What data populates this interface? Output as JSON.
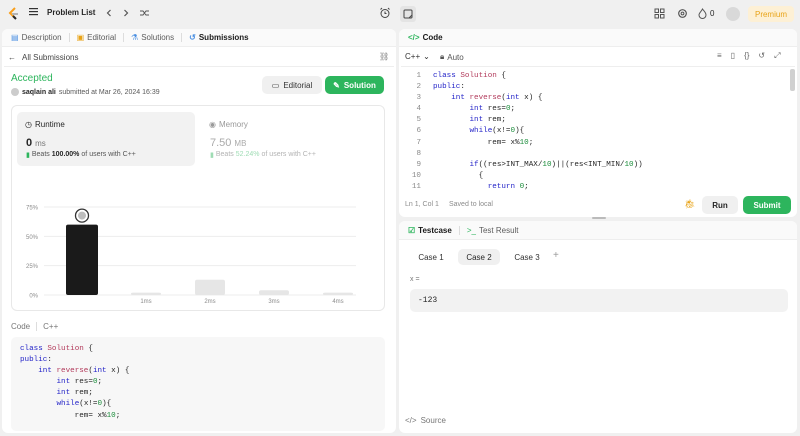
{
  "topbar": {
    "problem_list": "Problem List",
    "streak": "0",
    "premium": "Premium"
  },
  "left": {
    "tabs": [
      {
        "label": "Description"
      },
      {
        "label": "Editorial"
      },
      {
        "label": "Solutions"
      },
      {
        "label": "Submissions"
      }
    ],
    "back_label": "All Submissions",
    "status": "Accepted",
    "user": "saqlain ali",
    "submitted": "submitted at Mar 26, 2024 16:39",
    "editorial_btn": "Editorial",
    "solution_btn": "Solution",
    "runtime": {
      "title": "Runtime",
      "value": "0",
      "unit": "ms",
      "beats_label": "Beats",
      "beats_value": "100.00%",
      "beats_suffix": "of users with C++"
    },
    "memory": {
      "title": "Memory",
      "value": "7.50",
      "unit": "MB",
      "beats_label": "Beats",
      "beats_value": "52.24%",
      "beats_suffix": "of users with C++"
    },
    "code_label": "Code",
    "code_lang": "C++",
    "code_lines": [
      "class Solution {",
      "public:",
      "    int reverse(int x) {",
      "        int res=0;",
      "        int rem;",
      "        while(x!=0){",
      "            rem= x%10;"
    ]
  },
  "chart_data": {
    "type": "bar",
    "categories": [
      "0ms",
      "1ms",
      "2ms",
      "3ms",
      "4ms"
    ],
    "values": [
      60,
      2,
      13,
      4,
      2
    ],
    "yticks": [
      "75%",
      "50%",
      "25%",
      "0%"
    ],
    "ylim": [
      0,
      75
    ],
    "highlight_index": 0,
    "colors": {
      "highlight": "#1a1a1a",
      "other": "#e6e6e6"
    },
    "overview_labels": [
      "1ms",
      "2ms",
      "3ms",
      "4ms"
    ]
  },
  "editor": {
    "title": "Code",
    "lang": "C++",
    "mode": "Auto",
    "line_numbers": [
      "1",
      "2",
      "3",
      "4",
      "5",
      "6",
      "7",
      "8",
      "9",
      "10",
      "11"
    ],
    "lines": [
      "class Solution {",
      "public:",
      "    int reverse(int x) {",
      "        int res=0;",
      "        int rem;",
      "        while(x!=0){",
      "            rem= x%10;",
      "",
      "        if((res>INT_MAX/10)||(res<INT_MIN/10))",
      "          {",
      "            return 0;"
    ],
    "status_pos": "Ln 1, Col 1",
    "status_saved": "Saved to local",
    "run": "Run",
    "submit": "Submit"
  },
  "testcase": {
    "tab_label": "Testcase",
    "result_label": "Test Result",
    "cases": [
      "Case 1",
      "Case 2",
      "Case 3"
    ],
    "active_case": "Case 2",
    "var_label": "x =",
    "var_value": "-123",
    "source_label": "Source"
  }
}
